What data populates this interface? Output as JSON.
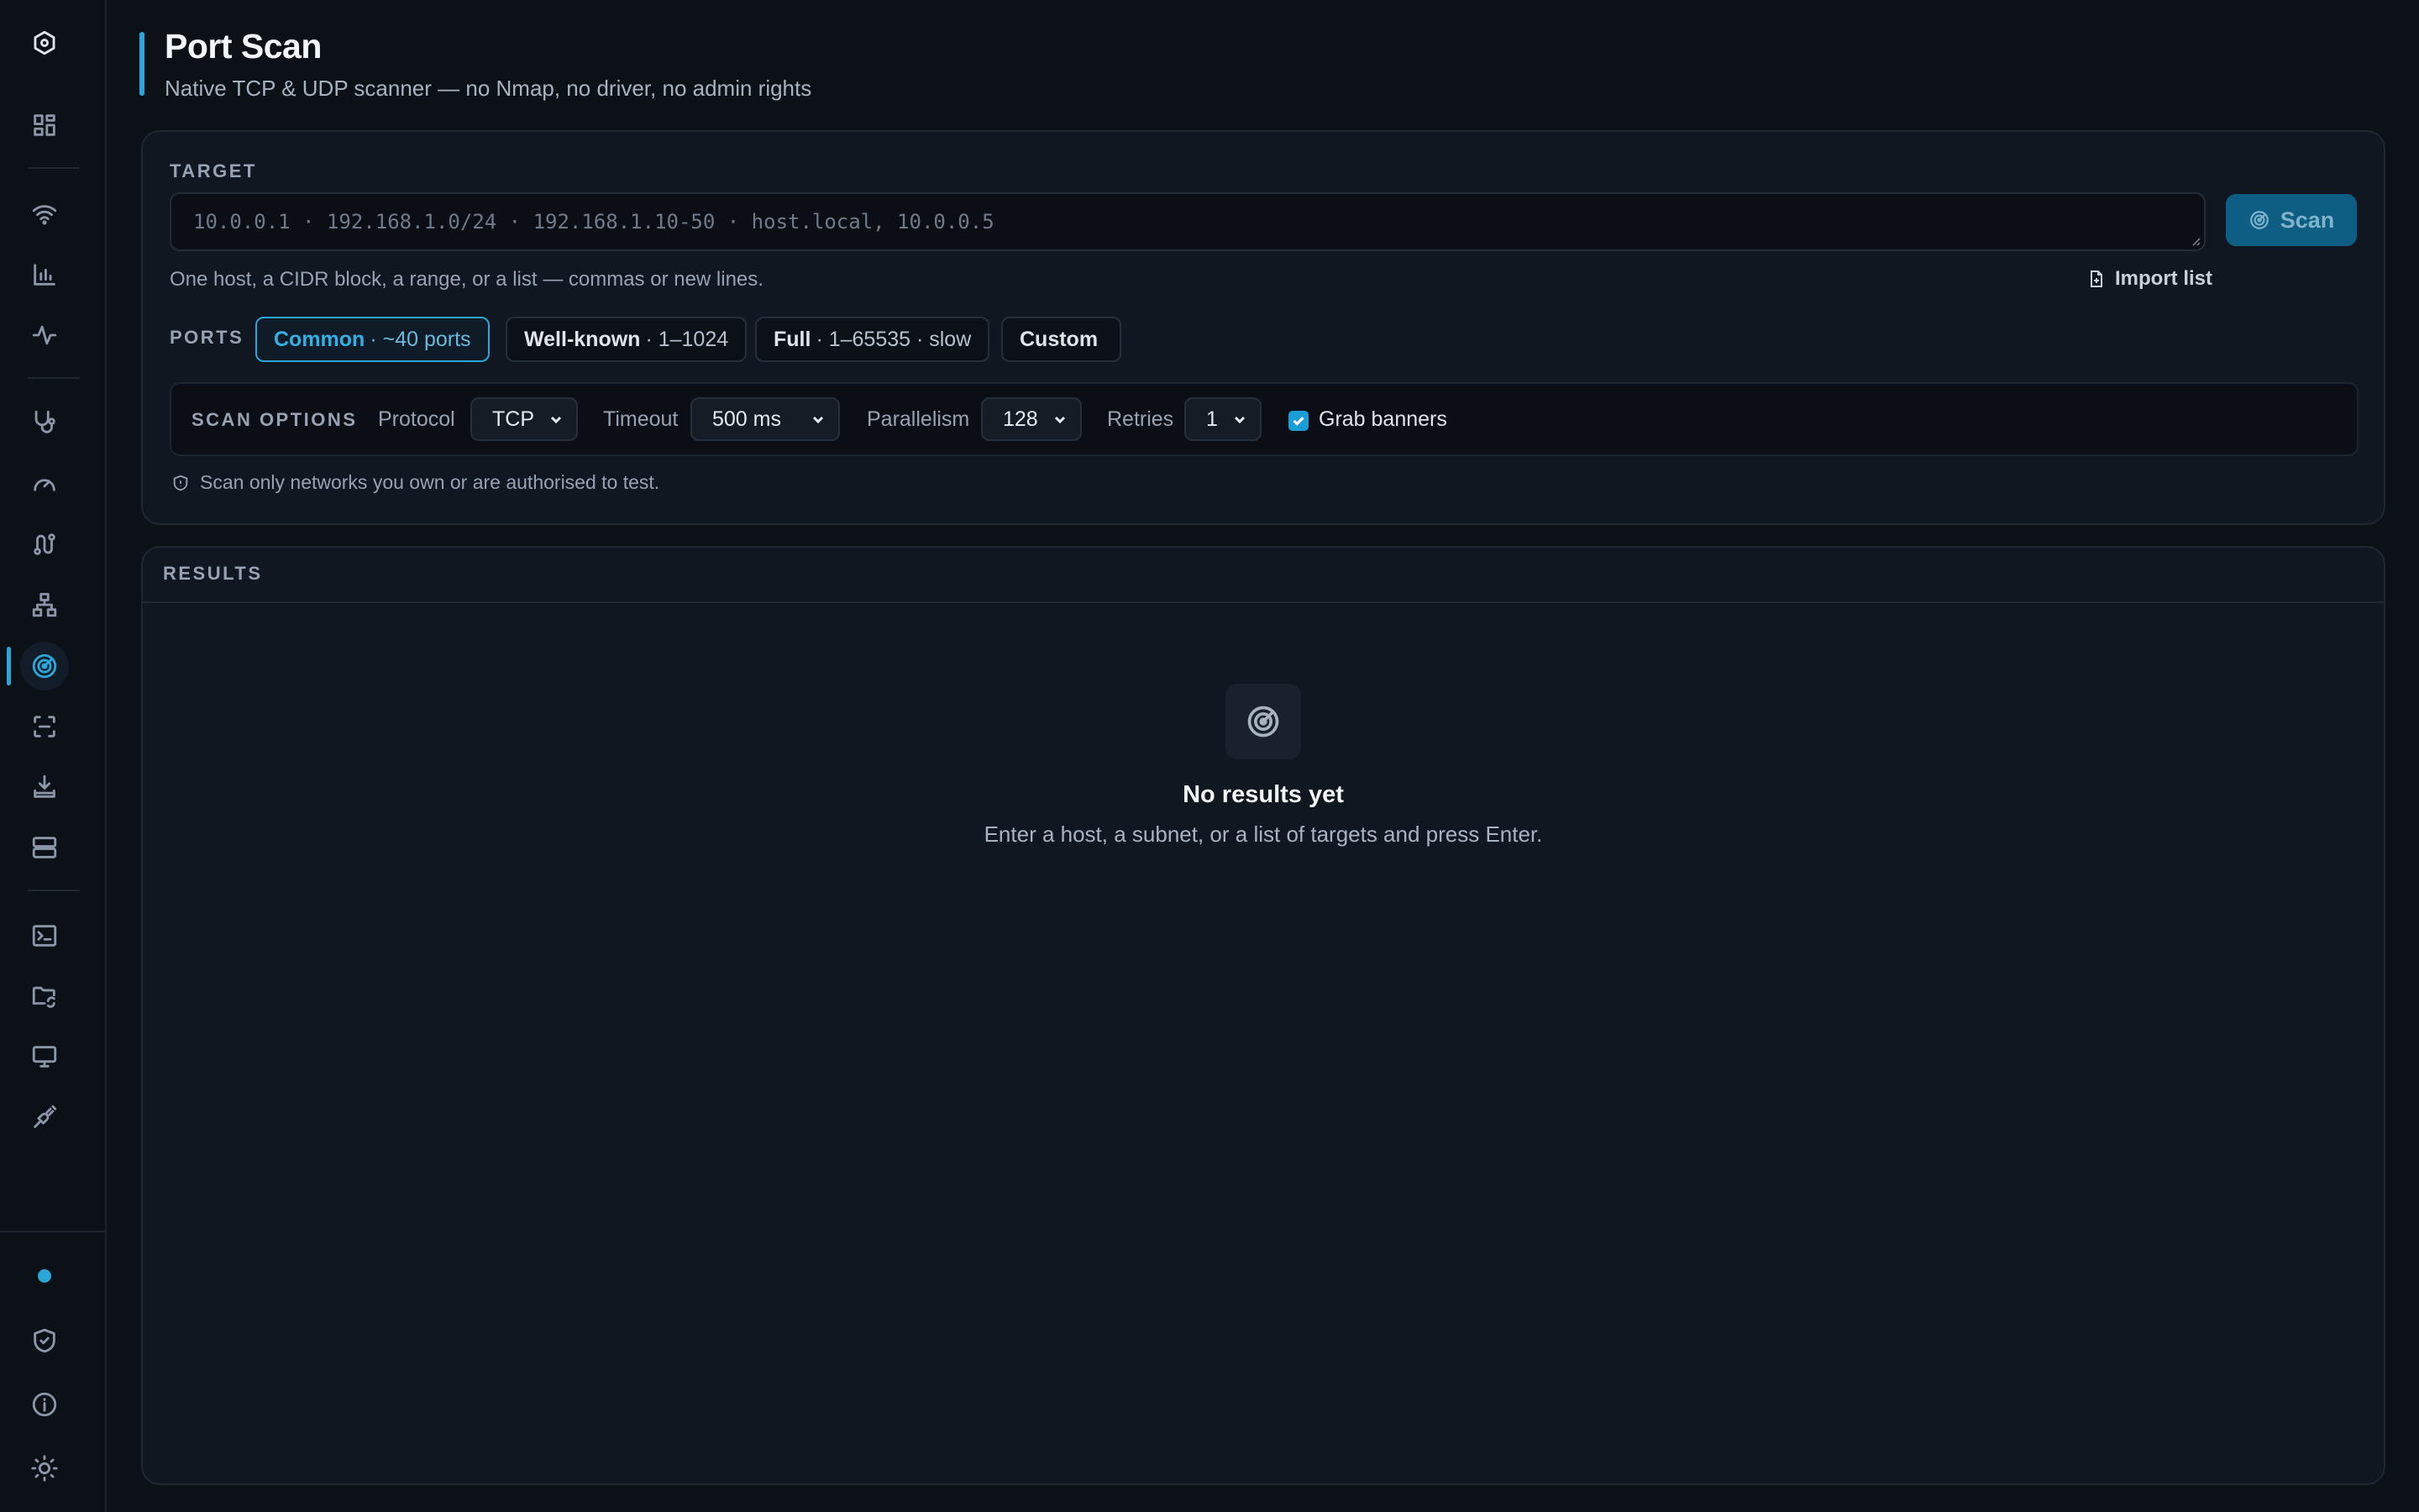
{
  "header": {
    "title": "Port Scan",
    "subtitle": "Native TCP & UDP scanner — no Nmap, no driver, no admin rights"
  },
  "sidebar": {
    "items": [
      {
        "icon": "app-logo-icon"
      },
      {
        "icon": "dashboard-icon"
      },
      {
        "icon": "wifi-icon"
      },
      {
        "icon": "bar-chart-icon"
      },
      {
        "icon": "activity-icon"
      },
      {
        "icon": "stethoscope-icon"
      },
      {
        "icon": "speedometer-icon"
      },
      {
        "icon": "route-icon"
      },
      {
        "icon": "network-topology-icon"
      },
      {
        "icon": "radar-icon",
        "active": true
      },
      {
        "icon": "scan-frame-icon"
      },
      {
        "icon": "download-tray-icon"
      },
      {
        "icon": "server-icon"
      },
      {
        "icon": "terminal-icon"
      },
      {
        "icon": "folder-sync-icon"
      },
      {
        "icon": "monitor-icon"
      },
      {
        "icon": "plug-icon"
      }
    ],
    "footer": [
      {
        "icon": "status-dot-icon"
      },
      {
        "icon": "shield-check-icon"
      },
      {
        "icon": "info-icon"
      },
      {
        "icon": "sun-icon"
      }
    ]
  },
  "target": {
    "label": "TARGET",
    "placeholder": "10.0.0.1 · 192.168.1.0/24 · 192.168.1.10-50 · host.local, 10.0.0.5",
    "helper": "One host, a CIDR block, a range, or a list — commas or new lines.",
    "import_label": "Import list",
    "scan_label": "Scan"
  },
  "ports": {
    "label": "PORTS",
    "presets": [
      {
        "name": "Common",
        "detail": "· ~40 ports",
        "active": true
      },
      {
        "name": "Well-known",
        "detail": "· 1–1024",
        "active": false
      },
      {
        "name": "Full",
        "detail": "· 1–65535 · slow",
        "active": false
      },
      {
        "name": "Custom",
        "detail": "",
        "active": false
      }
    ]
  },
  "options": {
    "label": "SCAN OPTIONS",
    "protocol_label": "Protocol",
    "protocol_value": "TCP",
    "timeout_label": "Timeout",
    "timeout_value": "500 ms",
    "parallelism_label": "Parallelism",
    "parallelism_value": "128",
    "retries_label": "Retries",
    "retries_value": "1",
    "grab_banners_label": "Grab banners",
    "grab_banners_checked": true
  },
  "warning": "Scan only networks you own or are authorised to test.",
  "results": {
    "label": "RESULTS",
    "empty_title": "No results yet",
    "empty_subtitle": "Enter a host, a subnet, or a list of targets and press Enter."
  },
  "colors": {
    "accent": "#2aa6d8",
    "background": "#0c1017",
    "card": "#111720",
    "scan_button": "#0e5e84"
  }
}
